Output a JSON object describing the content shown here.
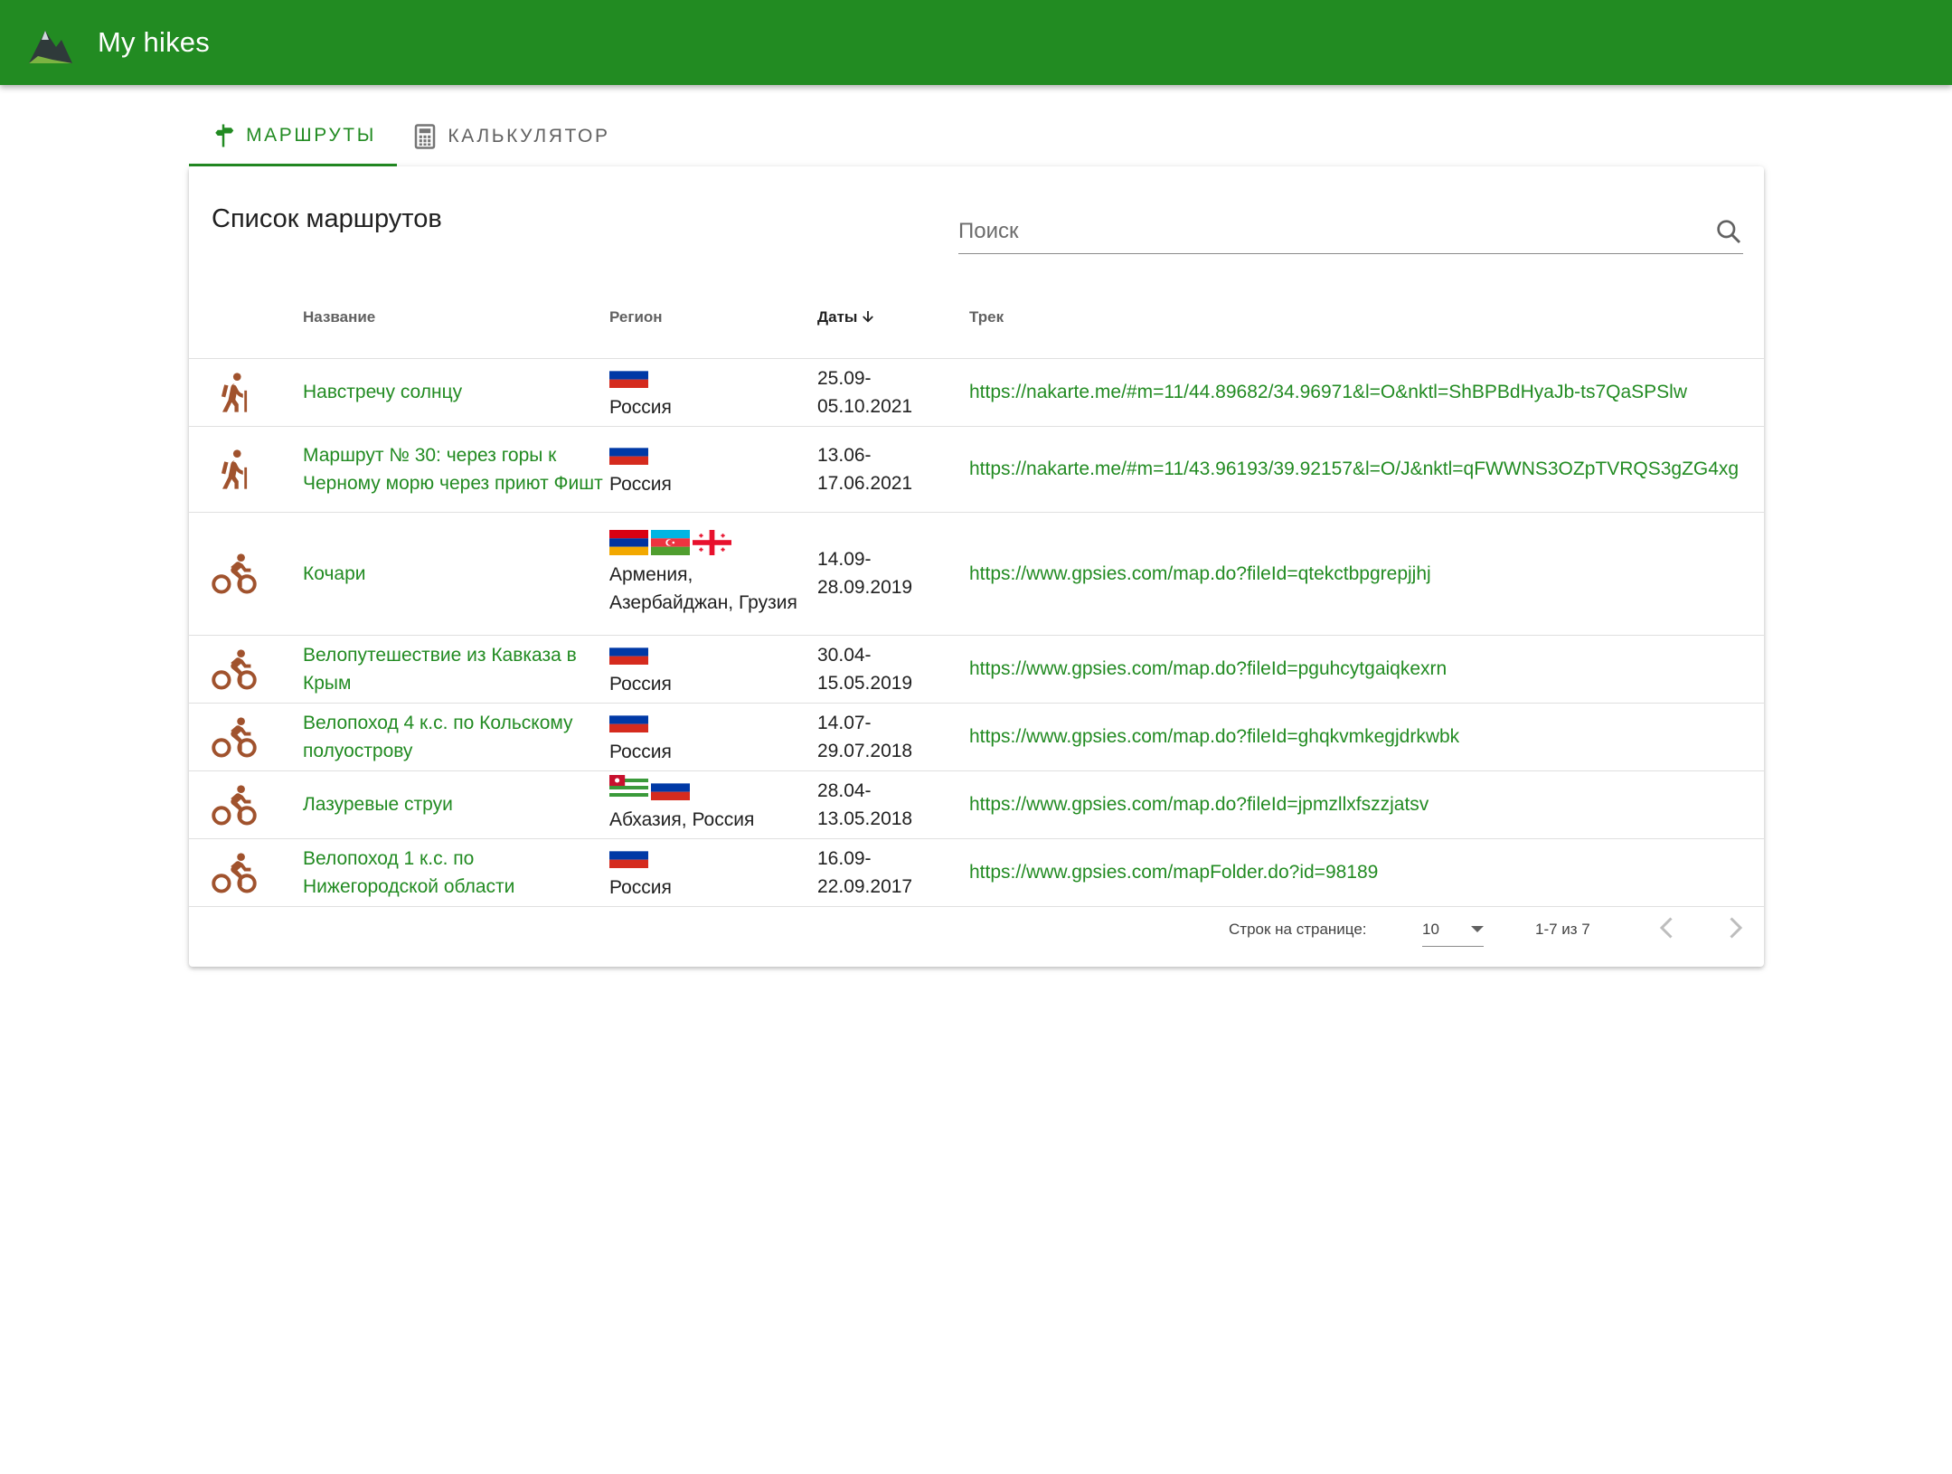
{
  "app": {
    "title": "My hikes",
    "logo_icon": "mountain-logo-icon"
  },
  "tabs": [
    {
      "label": "МАРШРУТЫ",
      "icon": "signpost-icon",
      "active": true
    },
    {
      "label": "КАЛЬКУЛЯТОР",
      "icon": "calculator-icon",
      "active": false
    }
  ],
  "card": {
    "title": "Список маршрутов",
    "search": {
      "placeholder": "Поиск",
      "value": ""
    }
  },
  "table": {
    "headers": {
      "name": "Название",
      "region": "Регион",
      "dates": "Даты",
      "track": "Трек"
    },
    "sort": {
      "column": "dates",
      "direction": "desc"
    },
    "rows": [
      {
        "type": "hiking",
        "name": "Навстречу солнцу",
        "flags": [
          "russia"
        ],
        "region": "Россия",
        "dates": "25.09-05.10.2021",
        "track": "https://nakarte.me/#m=11/44.89682/34.96971&l=O&nktl=ShBPBdHyaJb-ts7QaSPSlw"
      },
      {
        "type": "hiking",
        "name": "Маршрут № 30: через горы к Черному морю через приют Фишт",
        "flags": [
          "russia"
        ],
        "region": "Россия",
        "dates": "13.06-17.06.2021",
        "track": "https://nakarte.me/#m=11/43.96193/39.92157&l=O/J&nktl=qFWWNS3OZpTVRQS3gZG4xg"
      },
      {
        "type": "cycling",
        "name": "Кочари",
        "flags": [
          "armenia",
          "azerbaijan",
          "georgia"
        ],
        "region": "Армения, Азербайджан, Грузия",
        "dates": "14.09-28.09.2019",
        "track": "https://www.gpsies.com/map.do?fileId=qtekctbpgrepjjhj"
      },
      {
        "type": "cycling",
        "name": "Велопутешествие из Кавказа в Крым",
        "flags": [
          "russia"
        ],
        "region": "Россия",
        "dates": "30.04-15.05.2019",
        "track": "https://www.gpsies.com/map.do?fileId=pguhcytgaiqkexrn"
      },
      {
        "type": "cycling",
        "name": "Велопоход 4 к.с. по Кольскому полуострову",
        "flags": [
          "russia"
        ],
        "region": "Россия",
        "dates": "14.07-29.07.2018",
        "track": "https://www.gpsies.com/map.do?fileId=ghqkvmkegjdrkwbk"
      },
      {
        "type": "cycling",
        "name": "Лазуревые струи",
        "flags": [
          "abkhazia",
          "russia"
        ],
        "region": "Абхазия, Россия",
        "dates": "28.04-13.05.2018",
        "track": "https://www.gpsies.com/map.do?fileId=jpmzllxfszzjatsv"
      },
      {
        "type": "cycling",
        "name": "Велопоход 1 к.с. по Нижегородской области",
        "flags": [
          "russia"
        ],
        "region": "Россия",
        "dates": "16.09-22.09.2017",
        "track": "https://www.gpsies.com/mapFolder.do?id=98189"
      }
    ]
  },
  "pagination": {
    "rows_per_page_label": "Строк на странице:",
    "rows_per_page": "10",
    "range": "1-7 из 7"
  },
  "colors": {
    "primary": "#228b22",
    "icon_brown": "#a0522d"
  }
}
